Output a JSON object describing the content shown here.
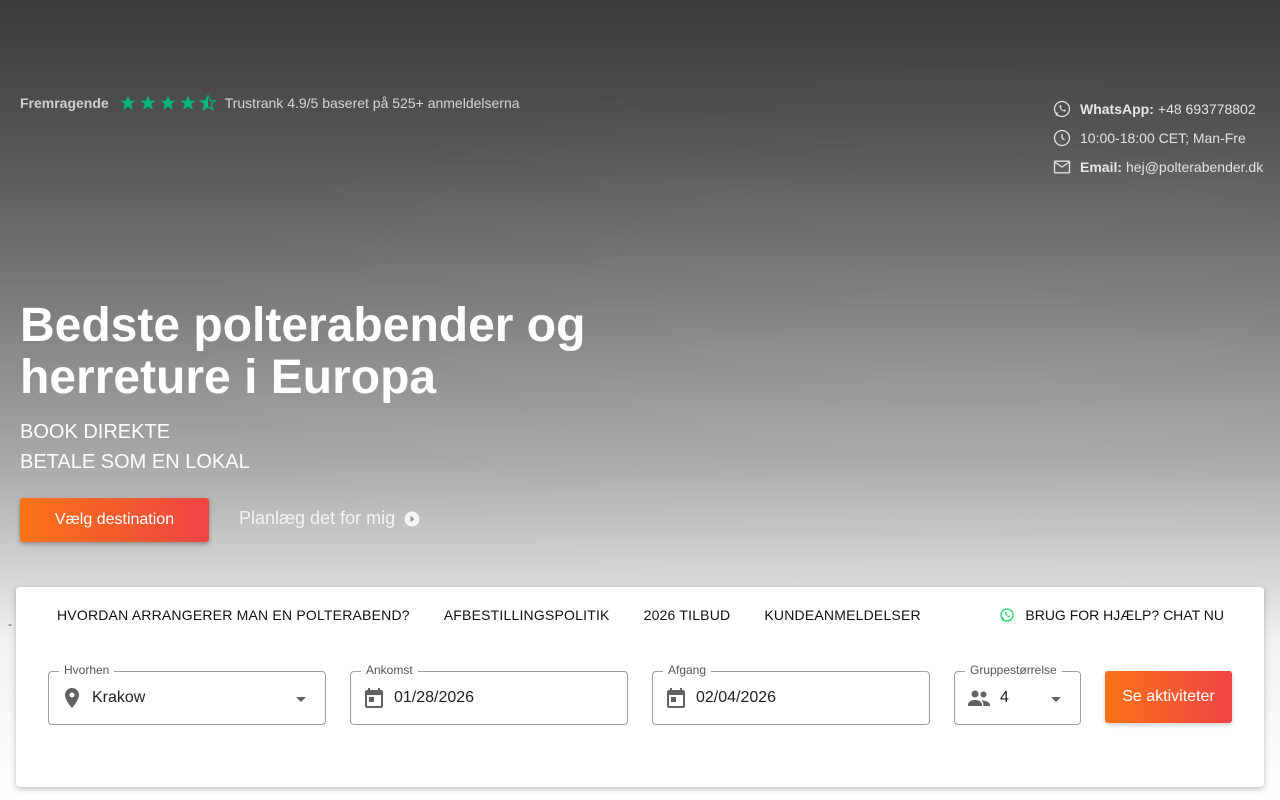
{
  "trust": {
    "label": "Fremragende",
    "rating": 4.5,
    "text": "Trustrank 4.9/5 baseret på 525+ anmeldelserna",
    "star_color": "#00b67a"
  },
  "contact": {
    "whatsapp_label": "WhatsApp:",
    "whatsapp_value": "+48 693778802",
    "hours": "10:00-18:00 CET; Man-Fre",
    "email_label": "Email:",
    "email_value": "hej@polterabender.dk",
    "icons": [
      "whatsapp-icon",
      "clock-icon",
      "mail-icon"
    ]
  },
  "hero": {
    "title": "Bedste polterabender og herreture i Europa",
    "sub1": "BOOK DIREKTE",
    "sub2": "BETALE SOM EN LOKAL",
    "primary_button": "Vælg destination",
    "plan_link": "Planlæg det for mig"
  },
  "misc": {
    "dash": "-"
  },
  "search": {
    "tabs": [
      "HVORDAN ARRANGERER MAN EN POLTERABEND?",
      "AFBESTILLINGSPOLITIK",
      "2026 TILBUD",
      "KUNDEANMELDELSER"
    ],
    "help": "BRUG FOR HJÆLP? CHAT NU",
    "where_label": "Hvorhen",
    "where_value": "Krakow",
    "arrival_label": "Ankomst",
    "arrival_value": "01/28/2026",
    "departure_label": "Afgang",
    "departure_value": "02/04/2026",
    "group_label": "Gruppestørrelse",
    "group_value": "4",
    "button": "Se aktiviteter"
  },
  "colors": {
    "accent_start": "#f97316",
    "accent_end": "#ef4444",
    "whatsapp_green": "#25d366"
  }
}
